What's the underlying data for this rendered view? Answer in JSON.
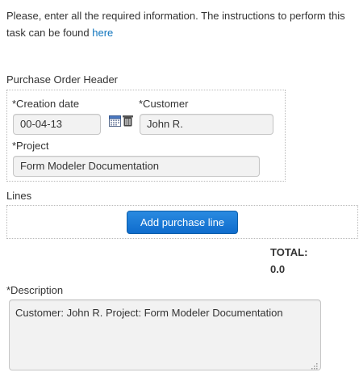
{
  "intro": {
    "text": "Please, enter all the required information. The instructions to perform this task can be found ",
    "link_label": "here"
  },
  "header_section": {
    "title": "Purchase Order Header",
    "creation_date": {
      "label": "*Creation date",
      "value": "00-04-13",
      "calendar_icon": "calendar-icon",
      "clear_icon": "trash-icon"
    },
    "customer": {
      "label": "*Customer",
      "value": "John R."
    },
    "project": {
      "label": "*Project",
      "value": "Form Modeler Documentation"
    }
  },
  "lines_section": {
    "title": "Lines",
    "add_button_label": "Add purchase line"
  },
  "total": {
    "label": "TOTAL:",
    "value": "0.0"
  },
  "description": {
    "label": "*Description",
    "value": "Customer: John R. Project: Form Modeler Documentation"
  },
  "colors": {
    "link": "#0f74bd",
    "primary_button": "#1a7ad6",
    "input_bg": "#f2f2f2"
  }
}
